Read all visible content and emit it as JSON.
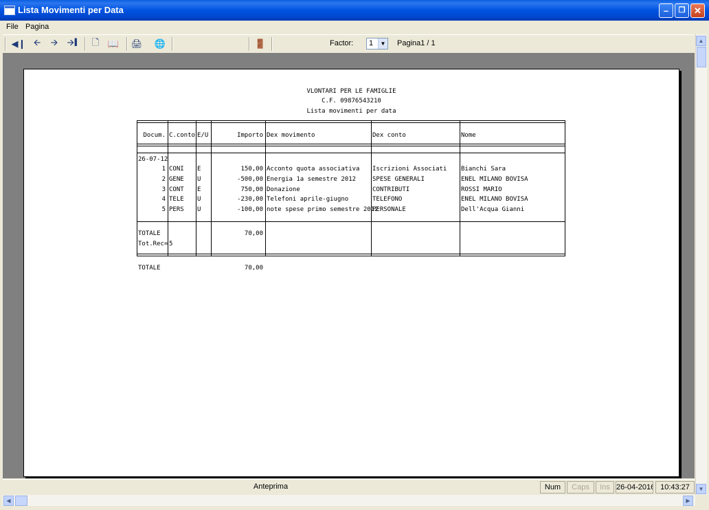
{
  "window": {
    "title": "Lista Movimenti per Data"
  },
  "menu": {
    "file": "File",
    "pagina": "Pagina"
  },
  "toolbar": {
    "factor_label": "Factor:",
    "factor_value": "1",
    "page_label": "Pagina1 / 1"
  },
  "report": {
    "org_name": "VLONTARI PER LE FAMIGLIE",
    "tax_code": "C.F. 09876543210",
    "subtitle": "Lista movimenti per data",
    "headers": {
      "docum": "Docum.",
      "conto": "C.conto",
      "eu": "E/U",
      "importo": "Importo",
      "desc_mov": "Dex movimento",
      "desc_conto": "Dex conto",
      "nome": "Nome"
    },
    "date": "26-07-12",
    "rows": [
      {
        "docum": "1",
        "conto": "CONI",
        "eu": "E",
        "importo": "150,00",
        "desc_mov": "Acconto quota associativa",
        "desc_conto": "Iscrizioni Associati",
        "nome": "Bianchi Sara"
      },
      {
        "docum": "2",
        "conto": "GENE",
        "eu": "U",
        "importo": "-500,00",
        "desc_mov": "Energia 1a semestre 2012",
        "desc_conto": "SPESE GENERALI",
        "nome": "ENEL MILANO BOVISA"
      },
      {
        "docum": "3",
        "conto": "CONT",
        "eu": "E",
        "importo": "750,00",
        "desc_mov": "Donazione",
        "desc_conto": "CONTRIBUTI",
        "nome": "ROSSI MARIO"
      },
      {
        "docum": "4",
        "conto": "TELE",
        "eu": "U",
        "importo": "-230,00",
        "desc_mov": "Telefoni aprile-giugno",
        "desc_conto": "TELEFONO",
        "nome": "ENEL MILANO BOVISA"
      },
      {
        "docum": "5",
        "conto": "PERS",
        "eu": "U",
        "importo": "-100,00",
        "desc_mov": "note spese primo semestre 2012",
        "desc_conto": "PERSONALE",
        "nome": "Dell'Acqua Gianni"
      }
    ],
    "subtotal_label": "TOTALE",
    "subtotal_value": "70,00",
    "totrec_label": "Tot.Rec=",
    "totrec_value": "5",
    "grand_total_label": "TOTALE",
    "grand_total_value": "70,00"
  },
  "status": {
    "center": "Anteprima",
    "num": "Num",
    "caps": "Caps",
    "ins": "Ins",
    "date": "26-04-2016",
    "time": "10:43:27"
  },
  "icons": [
    "first-page-icon",
    "prev-page-icon",
    "next-page-icon",
    "last-page-icon",
    "single-page-icon",
    "two-pages-icon",
    "print-icon",
    "export-icon",
    "exit-door-icon"
  ]
}
